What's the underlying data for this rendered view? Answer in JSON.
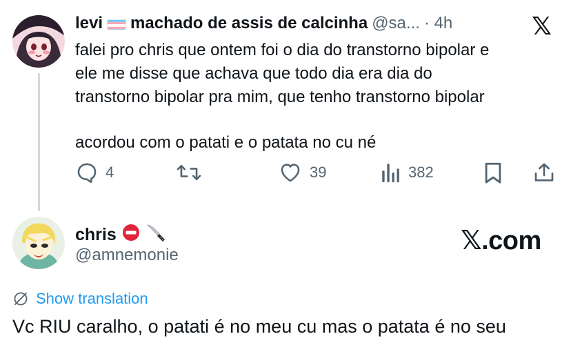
{
  "tweet": {
    "author_name": "levi",
    "flag": "transgender-flag",
    "display_suffix": "machado de assis de calcinha",
    "handle": "@sa...",
    "time": "· 4h",
    "brand_icon": "x-logo-icon",
    "lines": [
      "falei pro chris que ontem foi o dia do transtorno bipolar e",
      "ele me disse que achava que todo dia era dia do",
      "transtorno bipolar pra mim, que tenho transtorno bipolar",
      "acordou com o patati e o patata no cu né"
    ],
    "actions": {
      "replies": "4",
      "retweets": "",
      "likes": "39",
      "views": "382"
    }
  },
  "reply": {
    "author_name": "chris",
    "emojis": [
      "no-entry-icon",
      "knife-icon"
    ],
    "handle": "@amnemonie",
    "brand_text": "𝕏.com",
    "show_translation": "Show translation",
    "text": "Vc RIU caralho, o patati é no meu cu mas o patata é no seu"
  },
  "colors": {
    "text": "#0f1419",
    "muted": "#536471",
    "link": "#1d9bf0",
    "thread_line": "#cfd9de"
  }
}
